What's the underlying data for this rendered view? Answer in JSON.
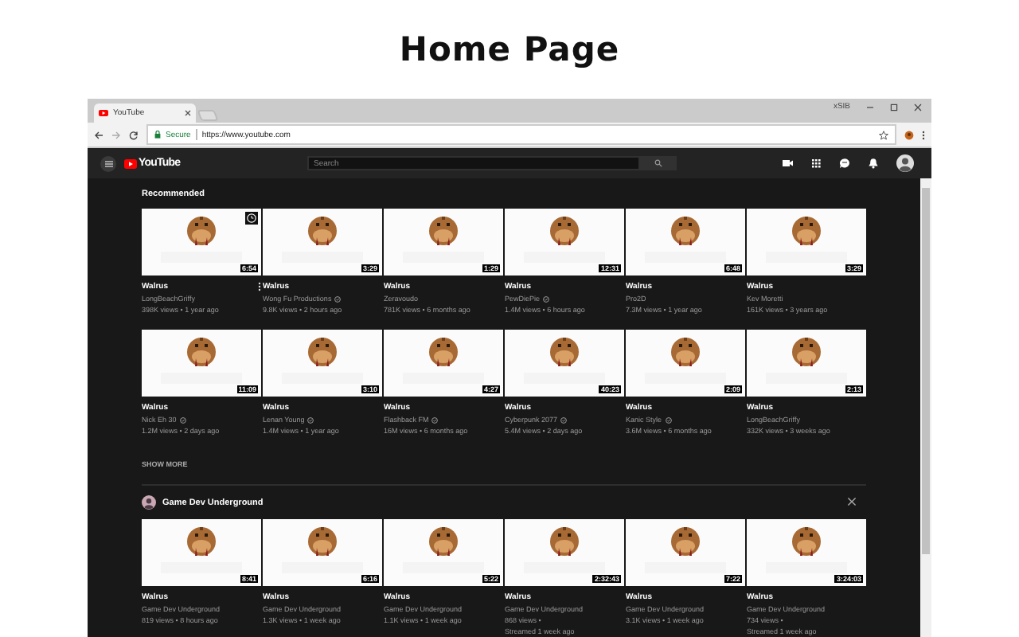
{
  "heading": "Home Page",
  "browser": {
    "tab": {
      "title": "YouTube"
    },
    "profile_label": "xSIB",
    "address": {
      "secure_label": "Secure",
      "url": "https://www.youtube.com"
    }
  },
  "header": {
    "logo": "YouTube",
    "search": {
      "placeholder": "Search"
    }
  },
  "sections": [
    {
      "kind": "shelf",
      "title": "Recommended",
      "show_more": "SHOW MORE",
      "videos": [
        {
          "title": "Walrus",
          "channel": "LongBeachGriffy",
          "verified": false,
          "meta": [
            "398K views • 1 year ago"
          ],
          "duration": "6:54",
          "hovered": true
        },
        {
          "title": "Walrus",
          "channel": "Wong Fu Productions",
          "verified": true,
          "meta": [
            "9.8K views • 2 hours ago"
          ],
          "duration": "3:29",
          "hovered": false
        },
        {
          "title": "Walrus",
          "channel": "Zeravoudo",
          "verified": false,
          "meta": [
            "781K views • 6 months ago"
          ],
          "duration": "1:29",
          "hovered": false
        },
        {
          "title": "Walrus",
          "channel": "PewDiePie",
          "verified": true,
          "meta": [
            "1.4M views • 6 hours ago"
          ],
          "duration": "12:31",
          "hovered": false
        },
        {
          "title": "Walrus",
          "channel": "Pro2D",
          "verified": false,
          "meta": [
            "7.3M views • 1 year ago"
          ],
          "duration": "6:48",
          "hovered": false
        },
        {
          "title": "Walrus",
          "channel": "Kev Moretti",
          "verified": false,
          "meta": [
            "161K views • 3 years ago"
          ],
          "duration": "3:29",
          "hovered": false
        },
        {
          "title": "Walrus",
          "channel": "Nick Eh 30",
          "verified": true,
          "meta": [
            "1.2M views • 2 days ago"
          ],
          "duration": "11:09",
          "hovered": false
        },
        {
          "title": "Walrus",
          "channel": "Lenan Young",
          "verified": true,
          "meta": [
            "1.4M views • 1 year ago"
          ],
          "duration": "3:10",
          "hovered": false
        },
        {
          "title": "Walrus",
          "channel": "Flashback FM",
          "verified": true,
          "meta": [
            "16M views • 6 months ago"
          ],
          "duration": "4:27",
          "hovered": false
        },
        {
          "title": "Walrus",
          "channel": "Cyberpunk 2077",
          "verified": true,
          "meta": [
            "5.4M views • 2 days ago"
          ],
          "duration": "40:23",
          "hovered": false
        },
        {
          "title": "Walrus",
          "channel": "Kanic Style",
          "verified": true,
          "meta": [
            "3.6M views • 6 months ago"
          ],
          "duration": "2:09",
          "hovered": false
        },
        {
          "title": "Walrus",
          "channel": "LongBeachGriffy",
          "verified": false,
          "meta": [
            "332K views • 3 weeks ago"
          ],
          "duration": "2:13",
          "hovered": false
        }
      ]
    },
    {
      "kind": "channel",
      "title": "Game Dev Underground",
      "videos": [
        {
          "title": "Walrus",
          "channel": "Game Dev Underground",
          "verified": false,
          "meta": [
            "819 views • 8 hours ago"
          ],
          "duration": "8:41",
          "hovered": false
        },
        {
          "title": "Walrus",
          "channel": "Game Dev Underground",
          "verified": false,
          "meta": [
            "1.3K views • 1 week ago"
          ],
          "duration": "6:16",
          "hovered": false
        },
        {
          "title": "Walrus",
          "channel": "Game Dev Underground",
          "verified": false,
          "meta": [
            "1.1K views • 1 week ago"
          ],
          "duration": "5:22",
          "hovered": false
        },
        {
          "title": "Walrus",
          "channel": "Game Dev Underground",
          "verified": false,
          "meta": [
            "868 views •",
            "Streamed 1 week ago"
          ],
          "duration": "2:32:43",
          "hovered": false
        },
        {
          "title": "Walrus",
          "channel": "Game Dev Underground",
          "verified": false,
          "meta": [
            "3.1K views • 1 week ago"
          ],
          "duration": "7:22",
          "hovered": false
        },
        {
          "title": "Walrus",
          "channel": "Game Dev Underground",
          "verified": false,
          "meta": [
            "734 views •",
            "Streamed 1 week ago"
          ],
          "duration": "3:24:03",
          "hovered": false
        }
      ]
    }
  ]
}
